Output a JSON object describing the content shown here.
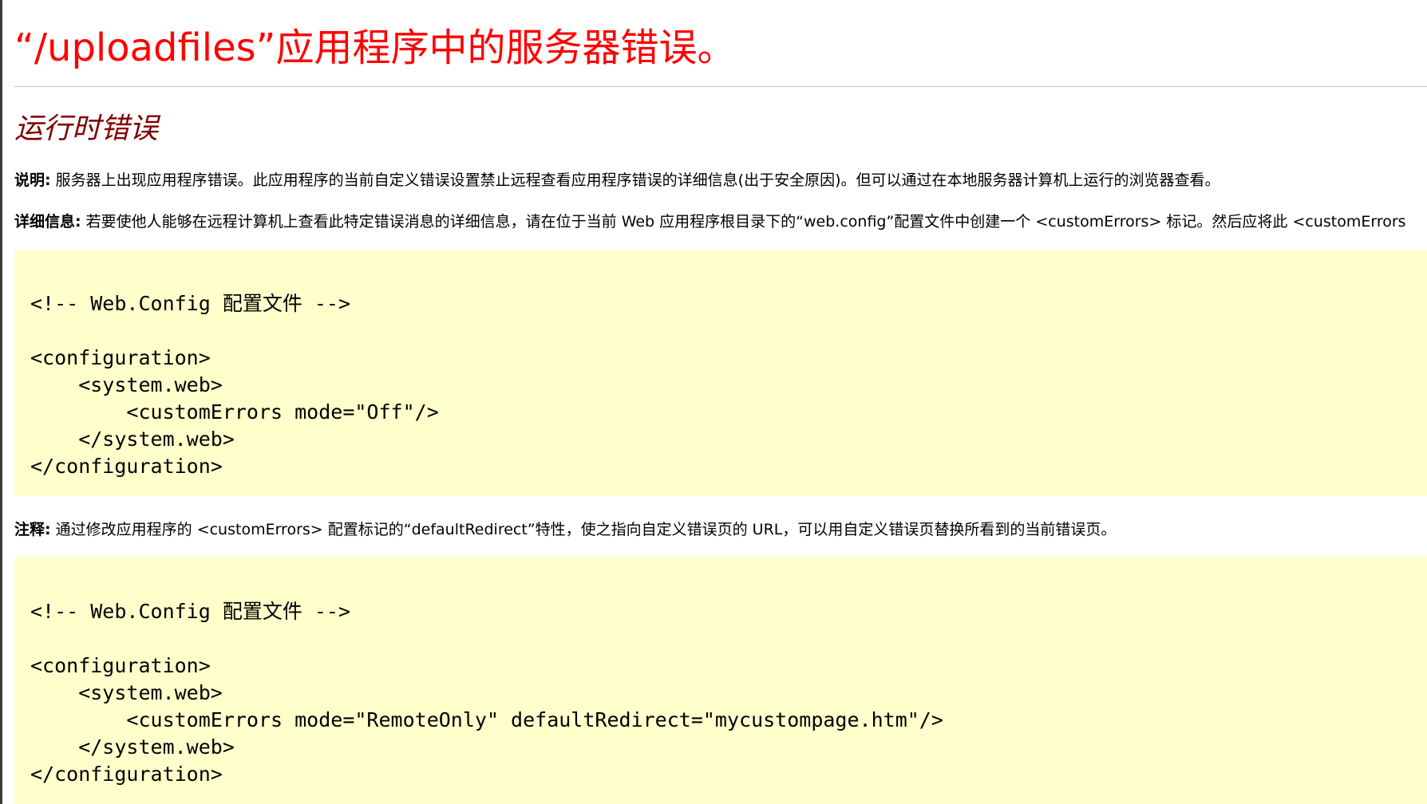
{
  "title": "“/uploadfiles”应用程序中的服务器错误。",
  "subtitle": "运行时错误",
  "description": {
    "label": "说明:",
    "text": " 服务器上出现应用程序错误。此应用程序的当前自定义错误设置禁止远程查看应用程序错误的详细信息(出于安全原因)。但可以通过在本地服务器计算机上运行的浏览器查看。"
  },
  "details": {
    "label": "详细信息:",
    "text": " 若要使他人能够在远程计算机上查看此特定错误消息的详细信息，请在位于当前 Web 应用程序根目录下的“web.config”配置文件中创建一个 <customErrors> 标记。然后应将此 <customErrors"
  },
  "code_block_1": "<!-- Web.Config 配置文件 -->\n\n<configuration>\n    <system.web>\n        <customErrors mode=\"Off\"/>\n    </system.web>\n</configuration>",
  "note": {
    "label": "注释:",
    "text": " 通过修改应用程序的 <customErrors> 配置标记的“defaultRedirect”特性，使之指向自定义错误页的 URL，可以用自定义错误页替换所看到的当前错误页。"
  },
  "code_block_2": "<!-- Web.Config 配置文件 -->\n\n<configuration>\n    <system.web>\n        <customErrors mode=\"RemoteOnly\" defaultRedirect=\"mycustompage.htm\"/>\n    </system.web>\n</configuration>",
  "colors": {
    "title": "#ff0000",
    "subtitle": "#800000",
    "code_background": "#ffffcc"
  }
}
